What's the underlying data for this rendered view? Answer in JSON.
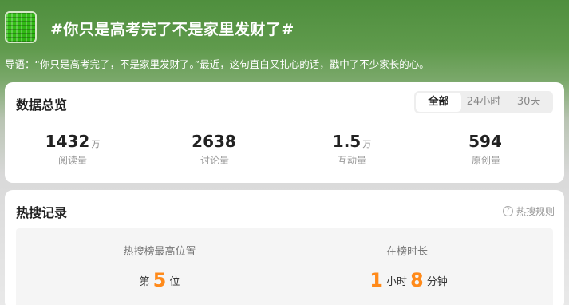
{
  "header": {
    "topic_title": "#你只是高考完了不是家里发财了#",
    "lead": "导语：“你只是高考完了，不是家里发财了。”最近，这句直白又扎心的话，戳中了不少家长的心。"
  },
  "overview": {
    "title": "数据总览",
    "tabs": [
      {
        "label": "全部",
        "active": true
      },
      {
        "label": "24小时",
        "active": false
      },
      {
        "label": "30天",
        "active": false
      }
    ],
    "stats": [
      {
        "value": "1432",
        "unit": "万",
        "label": "阅读量"
      },
      {
        "value": "2638",
        "unit": "",
        "label": "讨论量"
      },
      {
        "value": "1.5",
        "unit": "万",
        "label": "互动量"
      },
      {
        "value": "594",
        "unit": "",
        "label": "原创量"
      }
    ]
  },
  "hot": {
    "title": "热搜记录",
    "rule_label": "热搜规则",
    "rule_icon": "help-circle-icon",
    "best_position": {
      "label": "热搜榜最高位置",
      "prefix": "第",
      "value": "5",
      "suffix": "位"
    },
    "duration": {
      "label": "在榜时长",
      "hours": "1",
      "hours_unit": "小时",
      "minutes": "8",
      "minutes_unit": "分钟"
    }
  },
  "colors": {
    "accent": "#ff8a1a",
    "header_green": "#4f8f3e"
  }
}
